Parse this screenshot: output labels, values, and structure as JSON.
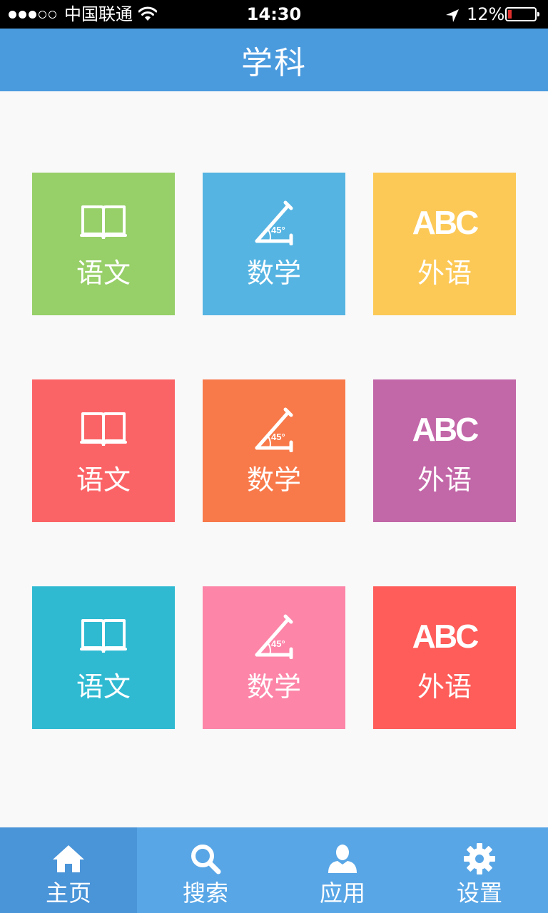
{
  "status_bar": {
    "carrier": "中国联通",
    "time": "14:30",
    "battery_text": "12%"
  },
  "nav": {
    "title": "学科"
  },
  "subjects": [
    {
      "label": "语文",
      "icon": "book-icon",
      "color": "#97cf68"
    },
    {
      "label": "数学",
      "icon": "angle-45-icon",
      "angle_text": "45°",
      "color": "#55b4e2"
    },
    {
      "label": "外语",
      "icon": "abc-icon",
      "abc_text": "ABC",
      "color": "#fcc957"
    },
    {
      "label": "语文",
      "icon": "book-icon",
      "color": "#fb6467"
    },
    {
      "label": "数学",
      "icon": "angle-45-icon",
      "angle_text": "45°",
      "color": "#f8794a"
    },
    {
      "label": "外语",
      "icon": "abc-icon",
      "abc_text": "ABC",
      "color": "#c267a8"
    },
    {
      "label": "语文",
      "icon": "book-icon",
      "color": "#2fbad2"
    },
    {
      "label": "数学",
      "icon": "angle-45-icon",
      "angle_text": "45°",
      "color": "#fc85a8"
    },
    {
      "label": "外语",
      "icon": "abc-icon",
      "abc_text": "ABC",
      "color": "#fe5d5a"
    }
  ],
  "tabs": [
    {
      "label": "主页",
      "icon": "home-icon",
      "active": true
    },
    {
      "label": "搜索",
      "icon": "search-icon",
      "active": false
    },
    {
      "label": "应用",
      "icon": "user-icon",
      "active": false
    },
    {
      "label": "设置",
      "icon": "gear-icon",
      "active": false
    }
  ],
  "colors": {
    "nav_bar": "#4a9ade",
    "tab_bar": "#58a6e6",
    "tab_active": "#4a94d8",
    "background": "#f9f9f9"
  }
}
